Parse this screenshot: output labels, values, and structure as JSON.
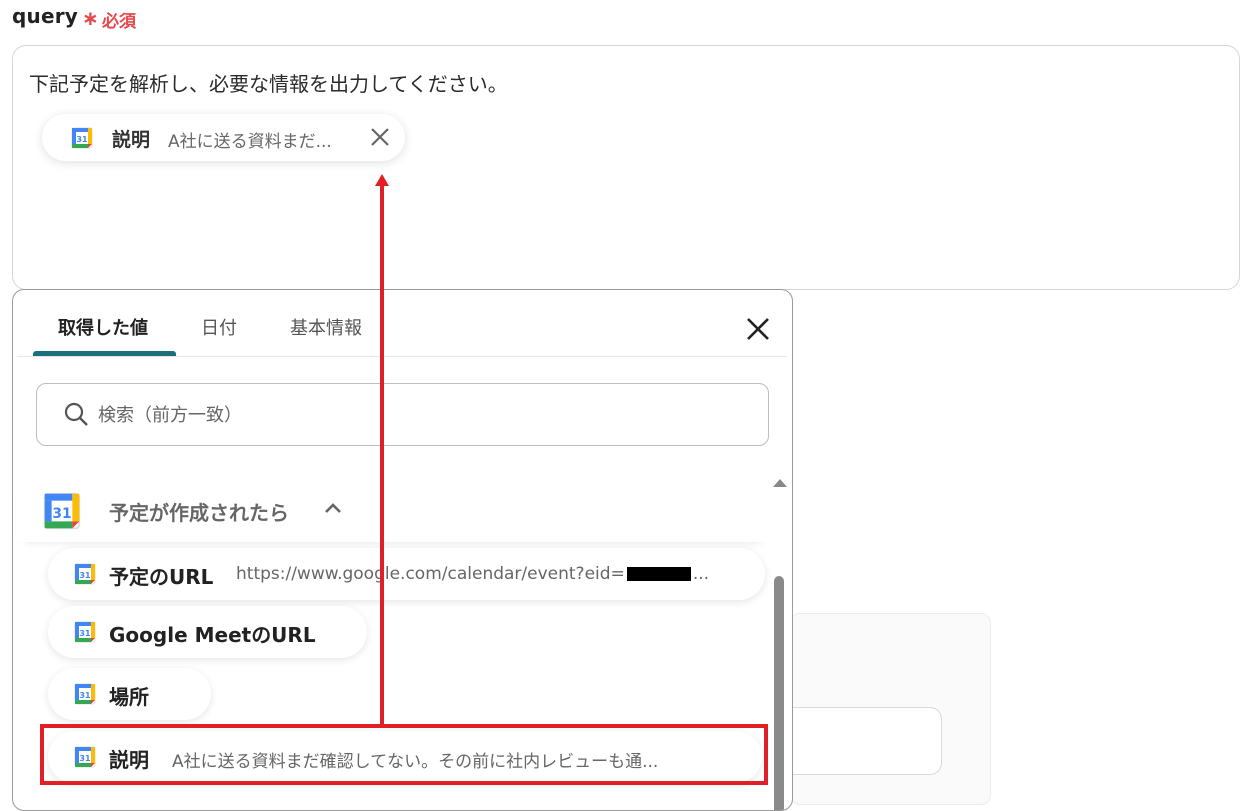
{
  "field": {
    "label": "query",
    "required_star": "∗",
    "required_text": "必須",
    "text": "下記予定を解析し、必要な情報を出力してください。"
  },
  "chip": {
    "icon": "google-calendar-icon",
    "label": "説明",
    "value": "A社に送る資料まだ..."
  },
  "popup": {
    "tabs": [
      {
        "label": "取得した値",
        "active": true
      },
      {
        "label": "日付",
        "active": false
      },
      {
        "label": "基本情報",
        "active": false
      }
    ],
    "search": {
      "placeholder": "検索（前方一致）",
      "value": ""
    },
    "section": {
      "icon": "google-calendar-icon",
      "title": "予定が作成されたら",
      "expanded": true
    },
    "items": [
      {
        "label": "予定のURL",
        "value_prefix": "https://www.google.com/calendar/event?eid=",
        "value_suffix": "..."
      },
      {
        "label": "Google MeetのURL",
        "value": ""
      },
      {
        "label": "場所",
        "value": ""
      },
      {
        "label": "説明",
        "value": "A社に送る資料まだ確認してない。その前に社内レビューも通..."
      }
    ]
  },
  "colors": {
    "accent": "#1b6f7a",
    "required": "#e5484d",
    "annotation": "#e01f26"
  }
}
